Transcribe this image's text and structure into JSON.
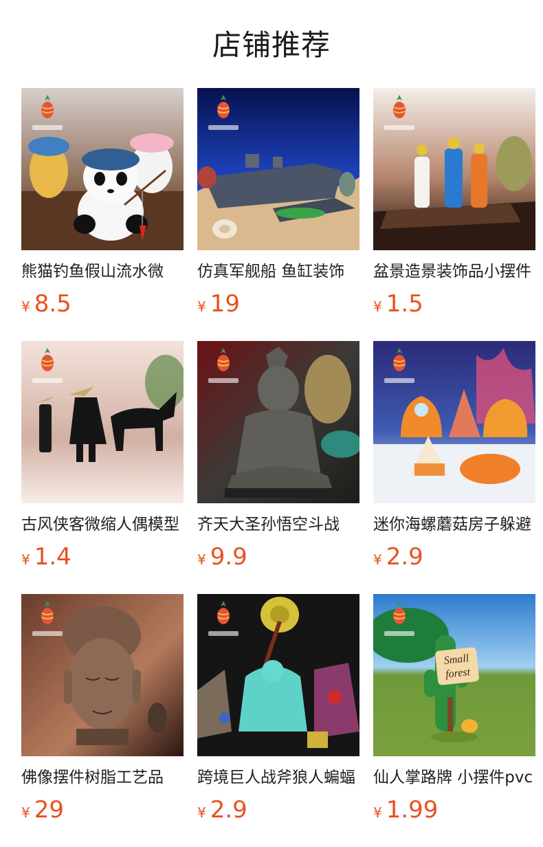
{
  "header": {
    "title": "店铺推荐"
  },
  "currency_symbol": "¥",
  "accent_color": "#e8501e",
  "products": [
    {
      "name": "熊猫钓鱼假山流水微",
      "price": "8.5",
      "icon": "panda-fishing-figurine"
    },
    {
      "name": "仿真军舰船 鱼缸装饰",
      "price": "19",
      "icon": "warship-aquarium-decor"
    },
    {
      "name": "盆景造景装饰品小摆件",
      "price": "1.5",
      "icon": "ancient-figures-figurine"
    },
    {
      "name": "古风侠客微缩人偶模型",
      "price": "1.4",
      "icon": "swordsman-horse-figurine"
    },
    {
      "name": "齐天大圣孙悟空斗战",
      "price": "9.9",
      "icon": "monkey-king-statue"
    },
    {
      "name": "迷你海螺蘑菇房子躲避",
      "price": "2.9",
      "icon": "mushroom-houses"
    },
    {
      "name": "佛像摆件树脂工艺品",
      "price": "29",
      "icon": "buddha-head-statue"
    },
    {
      "name": "跨境巨人战斧狼人蝙蝠",
      "price": "2.9",
      "icon": "giant-axe-warriors"
    },
    {
      "name": "仙人掌路牌 小摆件pvc",
      "price": "1.99",
      "icon": "cactus-signpost",
      "sign_text": "Small forest"
    }
  ]
}
